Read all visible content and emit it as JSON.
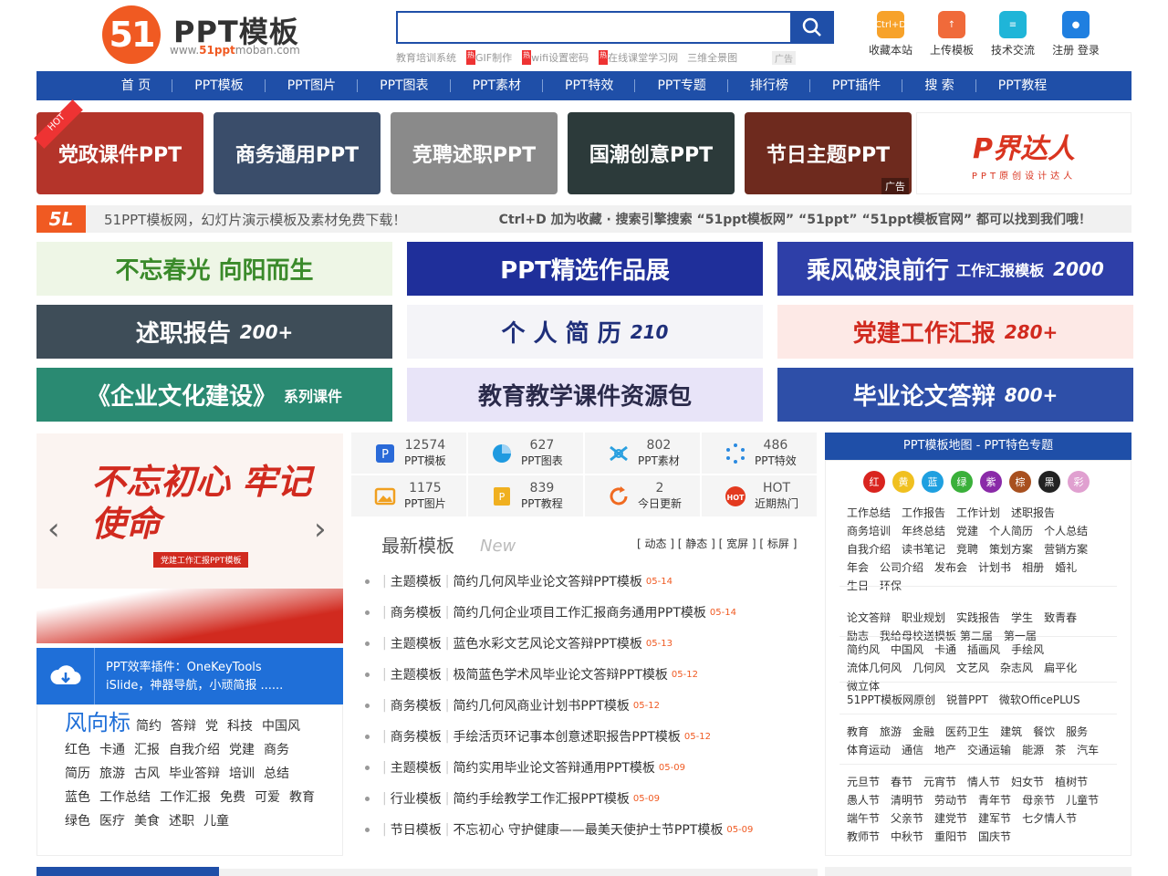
{
  "header": {
    "logo_badge": "51",
    "logo_title": "PPT模板",
    "logo_url_pre": "www.",
    "logo_url_hl": "51ppt",
    "logo_url_post": "moban.com",
    "search_placeholder": "",
    "hotwords": [
      {
        "label": "教育培训系统",
        "hot": "热"
      },
      {
        "label": "GIF制作",
        "hot": "热"
      },
      {
        "label": "wifi设置密码",
        "hot": "热"
      },
      {
        "label": "在线课堂学习网",
        "hot": ""
      },
      {
        "label": "三维全景图",
        "hot": ""
      }
    ],
    "ad_label": "广告",
    "tools": [
      {
        "label": "收藏本站",
        "icon": "bookmark-icon",
        "text": "Ctrl+D",
        "color": "#f7a22a"
      },
      {
        "label": "上传模板",
        "icon": "upload-icon",
        "text": "↑",
        "color": "#f06a3a"
      },
      {
        "label": "技术交流",
        "icon": "chat-icon",
        "text": "≡",
        "color": "#1fb5d8"
      },
      {
        "label": "注册 登录",
        "icon": "user-icon",
        "text": "●",
        "color": "#1f7fe0"
      }
    ]
  },
  "nav": [
    "首 页",
    "PPT模板",
    "PPT图片",
    "PPT图表",
    "PPT素材",
    "PPT特效",
    "PPT专题",
    "排行榜",
    "PPT插件",
    "搜 索",
    "PPT教程"
  ],
  "categories": [
    {
      "label": "党政课件PPT",
      "color": "#b4342a"
    },
    {
      "label": "商务通用PPT",
      "color": "#3a4d6a"
    },
    {
      "label": "竞聘述职PPT",
      "color": "#8a8a8a"
    },
    {
      "label": "国潮创意PPT",
      "color": "#2c3a3a"
    },
    {
      "label": "节日主题PPT",
      "color": "#6e2a1e"
    }
  ],
  "hot_ribbon": "HOT",
  "cat_ad": "广告",
  "pjdr": {
    "title": "P界达人",
    "sub": "PPT原创设计达人"
  },
  "slogan": {
    "mark": "5L",
    "left": "51PPT模板网，幻灯片演示模板及素材免费下载！",
    "right": "Ctrl+D 加为收藏 · 搜索引擎搜索 “51ppt模板网” “51ppt” “51ppt模板官网” 都可以找到我们哦！"
  },
  "promos": [
    {
      "title": "不忘春光 向阳而生",
      "sub": "",
      "num": "",
      "bg": "#eef6e6",
      "fg": "#3a8a2a"
    },
    {
      "title": "PPT精选作品展",
      "sub": "",
      "num": "",
      "bg": "#1f2f9a",
      "fg": "#ffffff"
    },
    {
      "title": "乘风破浪前行",
      "sub": "工作汇报模板",
      "num": "2000",
      "bg": "#2e3fa8",
      "fg": "#ffffff"
    },
    {
      "title": "述职报告",
      "sub": "",
      "num": "200+",
      "bg": "#3e4d58",
      "fg": "#ffffff"
    },
    {
      "title": "个 人 简 历",
      "sub": "",
      "num": "210",
      "bg": "#f4f4f8",
      "fg": "#1f2f7a"
    },
    {
      "title": "党建工作汇报",
      "sub": "",
      "num": "280+",
      "bg": "#fde9e6",
      "fg": "#d12a1f"
    },
    {
      "title": "《企业文化建设》",
      "sub": "系列课件",
      "num": "",
      "bg": "#2a8a72",
      "fg": "#ffffff"
    },
    {
      "title": "教育教学课件资源包",
      "sub": "",
      "num": "",
      "bg": "#e8e4f8",
      "fg": "#2a2a4a"
    },
    {
      "title": "毕业论文答辩",
      "sub": "",
      "num": "800+",
      "bg": "#2e4fa8",
      "fg": "#ffffff"
    }
  ],
  "carousel": {
    "title": "不忘初心 牢记使命",
    "badge": "党建工作汇报PPT模板",
    "prev": "‹",
    "next": "›"
  },
  "plugin": {
    "line1": "PPT效率插件：OneKeyTools",
    "line2": "iSlide，神器导航，小顽简报 ......"
  },
  "trend": {
    "title": "风向标",
    "words": [
      "简约",
      "答辩",
      "党",
      "科技",
      "中国风",
      "红色",
      "卡通",
      "汇报",
      "自我介绍",
      "党建",
      "商务",
      "简历",
      "旅游",
      "古风",
      "毕业答辩",
      "培训",
      "总结",
      "蓝色",
      "工作总结",
      "工作汇报",
      "免费",
      "可爱",
      "教育",
      "绿色",
      "医疗",
      "美食",
      "述职",
      "儿童"
    ]
  },
  "stats": [
    {
      "num": "12574",
      "label": "PPT模板",
      "icon": "ppt-icon",
      "color": "#2a6ad8"
    },
    {
      "num": "627",
      "label": "PPT图表",
      "icon": "pie-chart-icon",
      "color": "#1f9ae0"
    },
    {
      "num": "802",
      "label": "PPT素材",
      "icon": "material-icon",
      "color": "#2aa0e0"
    },
    {
      "num": "486",
      "label": "PPT特效",
      "icon": "effect-icon",
      "color": "#2a8ae0"
    },
    {
      "num": "1175",
      "label": "PPT图片",
      "icon": "image-icon",
      "color": "#f0a020"
    },
    {
      "num": "839",
      "label": "PPT教程",
      "icon": "tutorial-icon",
      "color": "#f0b020"
    },
    {
      "num": "2",
      "label": "今日更新",
      "icon": "refresh-icon",
      "color": "#f06a20"
    },
    {
      "num": "HOT",
      "label": "近期热门",
      "icon": "hot-icon",
      "color": "#e33a1f"
    }
  ],
  "latest": {
    "title": "最新模板",
    "new_label": "New",
    "filter": "[ 动态 ] [ 静态 ] [ 宽屏 ] [ 标屏 ]",
    "items": [
      {
        "cat": "主题模板",
        "title": "简约几何风毕业论文答辩PPT模板",
        "date": "05-14"
      },
      {
        "cat": "商务模板",
        "title": "简约几何企业项目工作汇报商务通用PPT模板",
        "date": "05-14"
      },
      {
        "cat": "主题模板",
        "title": "蓝色水彩文艺风论文答辩PPT模板",
        "date": "05-13"
      },
      {
        "cat": "主题模板",
        "title": "极简蓝色学术风毕业论文答辩PPT模板",
        "date": "05-12"
      },
      {
        "cat": "商务模板",
        "title": "简约几何风商业计划书PPT模板",
        "date": "05-12"
      },
      {
        "cat": "商务模板",
        "title": "手绘活页环记事本创意述职报告PPT模板",
        "date": "05-12"
      },
      {
        "cat": "主题模板",
        "title": "简约实用毕业论文答辩通用PPT模板",
        "date": "05-09"
      },
      {
        "cat": "行业模板",
        "title": "简约手绘教学工作汇报PPT模板",
        "date": "05-09"
      },
      {
        "cat": "节日模板",
        "title": "不忘初心 守护健康——最美天使护士节PPT模板",
        "date": "05-09"
      }
    ]
  },
  "map": {
    "title": "PPT模板地图 - PPT特色专题",
    "colors": [
      {
        "label": "红",
        "color": "#d9241f"
      },
      {
        "label": "黄",
        "color": "#f0c020"
      },
      {
        "label": "蓝",
        "color": "#1fa0e0"
      },
      {
        "label": "绿",
        "color": "#3ab03a"
      },
      {
        "label": "紫",
        "color": "#8a2aa8"
      },
      {
        "label": "棕",
        "color": "#a8501f"
      },
      {
        "label": "黑",
        "color": "#222222"
      },
      {
        "label": "彩",
        "color": "#e0a0d0"
      }
    ],
    "groups": [
      [
        "工作总结",
        "工作报告",
        "工作计划",
        "述职报告",
        "商务培训",
        "年终总结",
        "党建",
        "个人简历",
        "个人总结",
        "自我介绍",
        "读书笔记",
        "竞聘",
        "策划方案",
        "营销方案",
        "年会",
        "公司介绍",
        "发布会",
        "计划书",
        "相册",
        "婚礼",
        "生日",
        "环保"
      ],
      [
        "论文答辩",
        "职业规划",
        "实践报告",
        "学生",
        "致青春",
        "励志",
        "我给母校送模板 第二届",
        "第一届"
      ],
      [
        "简约风",
        "中国风",
        "卡通",
        "插画风",
        "手绘风",
        "流体几何风",
        "几何风",
        "文艺风",
        "杂志风",
        "扁平化",
        "微立体"
      ],
      [
        "51PPT模板网原创",
        "锐普PPT",
        "微软OfficePLUS"
      ],
      [
        "教育",
        "旅游",
        "金融",
        "医药卫生",
        "建筑",
        "餐饮",
        "服务",
        "体育运动",
        "通信",
        "地产",
        "交通运输",
        "能源",
        "茶",
        "汽车"
      ],
      [
        "元旦节",
        "春节",
        "元宵节",
        "情人节",
        "妇女节",
        "植树节",
        "愚人节",
        "清明节",
        "劳动节",
        "青年节",
        "母亲节",
        "儿童节",
        "端午节",
        "父亲节",
        "建党节",
        "建军节",
        "七夕情人节",
        "教师节",
        "中秋节",
        "重阳节",
        "国庆节"
      ]
    ]
  }
}
